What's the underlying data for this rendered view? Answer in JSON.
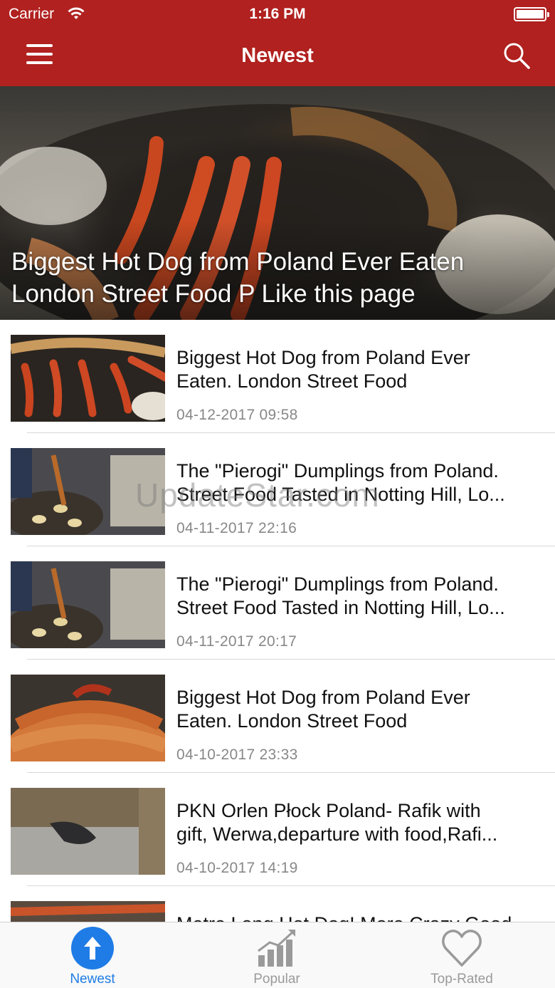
{
  "status": {
    "carrier": "Carrier",
    "time": "1:16 PM"
  },
  "nav": {
    "title": "Newest",
    "menu_icon": "hamburger-menu-icon",
    "search_icon": "search-icon"
  },
  "hero": {
    "title": "Biggest Hot Dog from Poland Ever Eaten London Street Food  P Like this page"
  },
  "watermark": "UpdateStar.com",
  "items": [
    {
      "title_line1": "Biggest Hot Dog from Poland Ever",
      "title_line2": "Eaten. London Street Food",
      "date": "04-12-2017 09:58"
    },
    {
      "title_line1": "The \"Pierogi\" Dumplings from Poland.",
      "title_line2": "Street Food Tasted in Notting Hill, Lo...",
      "date": "04-11-2017 22:16"
    },
    {
      "title_line1": "The \"Pierogi\" Dumplings from Poland.",
      "title_line2": "Street Food Tasted in Notting Hill, Lo...",
      "date": "04-11-2017 20:17"
    },
    {
      "title_line1": "Biggest Hot Dog from Poland Ever",
      "title_line2": "Eaten. London Street Food",
      "date": "04-10-2017 23:33"
    },
    {
      "title_line1": "PKN Orlen Płock Poland- Rafik with",
      "title_line2": "gift, Werwa,departure with food,Rafi...",
      "date": "04-10-2017 14:19"
    },
    {
      "title_line1": "Metre Long Hot Dog! More Crazy Good",
      "title_line2": "",
      "date": ""
    }
  ],
  "tabs": [
    {
      "label": "Newest",
      "icon": "up-arrow-circle-icon",
      "active": true
    },
    {
      "label": "Popular",
      "icon": "bar-chart-trend-icon",
      "active": false
    },
    {
      "label": "Top-Rated",
      "icon": "heart-icon",
      "active": false
    }
  ],
  "colors": {
    "brand_red": "#b0211f",
    "active_tab": "#1f7ce6",
    "inactive_tab": "#9a9a9a"
  }
}
